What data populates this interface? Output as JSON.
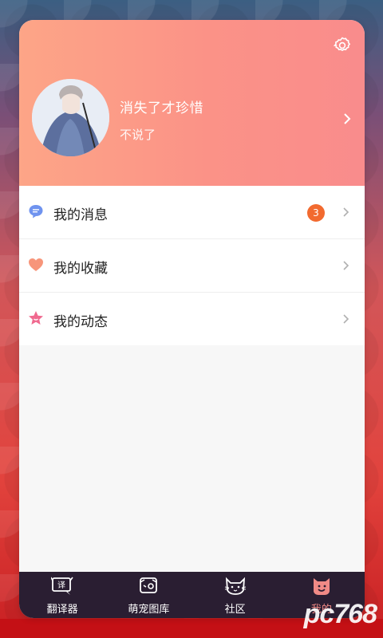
{
  "profile": {
    "username": "消失了才珍惜",
    "signature": "不说了"
  },
  "menu": {
    "items": [
      {
        "label": "我的消息",
        "badge": "3",
        "icon": "message-icon"
      },
      {
        "label": "我的收藏",
        "icon": "heart-icon"
      },
      {
        "label": "我的动态",
        "icon": "star-icon"
      }
    ]
  },
  "tabbar": {
    "tabs": [
      {
        "label": "翻译器",
        "icon": "translator-icon"
      },
      {
        "label": "萌宠图库",
        "icon": "pet-gallery-icon"
      },
      {
        "label": "社区",
        "icon": "cat-community-icon"
      },
      {
        "label": "我的",
        "icon": "smile-profile-icon",
        "active": true
      }
    ]
  },
  "watermark": {
    "text": "pc768"
  },
  "colors": {
    "header_start": "#fda587",
    "header_end": "#f98c8c",
    "badge": "#f26a2f",
    "tabbar": "#2a1e32",
    "active_tab": "#f08a86"
  }
}
